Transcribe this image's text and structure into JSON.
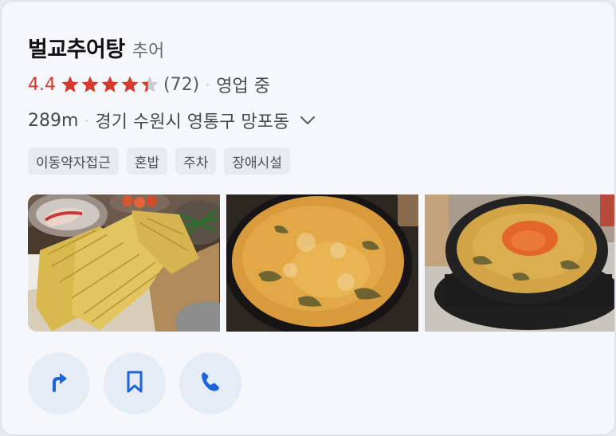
{
  "place": {
    "name": "벌교추어탕",
    "category": "추어",
    "rating": "4.4",
    "stars_value": 4.4,
    "stars_max": 5,
    "review_count": "(72)",
    "status": "영업 중",
    "distance": "289m",
    "address": "경기 수원시 영통구 망포동",
    "dot_separator": "·"
  },
  "tags": [
    "이동약자접근",
    "혼밥",
    "주차",
    "장애시설"
  ],
  "photos": [
    {
      "icon": "photo-fried-loach"
    },
    {
      "icon": "photo-loach-soup"
    },
    {
      "icon": "photo-soup-pot"
    }
  ],
  "actions": [
    {
      "icon": "directions-icon"
    },
    {
      "icon": "bookmark-icon"
    },
    {
      "icon": "phone-icon"
    }
  ],
  "colors": {
    "rating": "#d63a2e",
    "star_filled": "#d63a2e",
    "star_empty": "#c9cdd2",
    "action_bg": "#e6ecf6",
    "action_icon": "#1b64da"
  }
}
